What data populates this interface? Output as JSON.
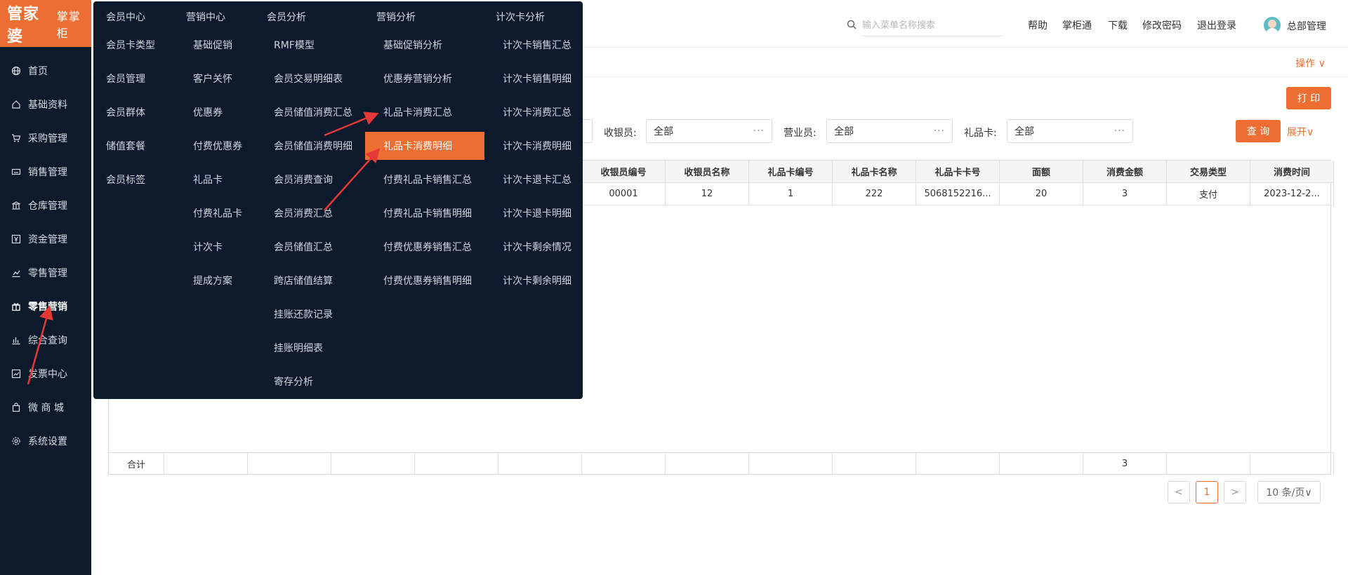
{
  "brand": {
    "name": "管家婆",
    "sub": "掌掌柜"
  },
  "sidebar": {
    "items": [
      {
        "label": "首页",
        "icon": "globe-icon"
      },
      {
        "label": "基础资料",
        "icon": "home-icon"
      },
      {
        "label": "采购管理",
        "icon": "cart-icon"
      },
      {
        "label": "销售管理",
        "icon": "keyboard-icon"
      },
      {
        "label": "仓库管理",
        "icon": "bank-icon"
      },
      {
        "label": "资金管理",
        "icon": "yen-icon"
      },
      {
        "label": "零售管理",
        "icon": "chart-icon"
      },
      {
        "label": "零售营销",
        "icon": "gift-icon"
      },
      {
        "label": "综合查询",
        "icon": "bars-icon"
      },
      {
        "label": "发票中心",
        "icon": "trend-icon"
      },
      {
        "label": "微 商 城",
        "icon": "bag-icon"
      },
      {
        "label": "系统设置",
        "icon": "settings-icon"
      }
    ]
  },
  "header": {
    "search_placeholder": "输入菜单名称搜索",
    "links": [
      "帮助",
      "掌柜通",
      "下载",
      "修改密码",
      "退出登录"
    ],
    "user": "总部管理"
  },
  "toolbar": {
    "ops": "操作 ∨",
    "print": "打 印",
    "query": "查 询",
    "expand": "展开∨"
  },
  "filters": [
    {
      "label": "收银员:",
      "value": "全部"
    },
    {
      "label": "营业员:",
      "value": "全部"
    },
    {
      "label": "礼品卡:",
      "value": "全部"
    }
  ],
  "table": {
    "headers": [
      "收银员编号",
      "收银员名称",
      "礼品卡编号",
      "礼品卡名称",
      "礼品卡卡号",
      "面额",
      "消费金额",
      "交易类型",
      "消费时间"
    ],
    "rows": [
      [
        "00001",
        "12",
        "1",
        "222",
        "5068152216...",
        "20",
        "3",
        "支付",
        "2023-12-2..."
      ]
    ],
    "footer_label": "合计",
    "footer_total": "3"
  },
  "pagination": {
    "prev": "<",
    "current": "1",
    "next": ">",
    "size": "10 条/页∨"
  },
  "mega_menu": {
    "columns": [
      {
        "title": "会员中心",
        "items": [
          "会员卡类型",
          "会员管理",
          "会员群体",
          "储值套餐",
          "会员标签"
        ]
      },
      {
        "title": "营销中心",
        "items": [
          "基础促销",
          "客户关怀",
          "优惠券",
          "付费优惠券",
          "礼品卡",
          "付费礼品卡",
          "计次卡",
          "提成方案"
        ]
      },
      {
        "title": "会员分析",
        "items": [
          "RMF模型",
          "会员交易明细表",
          "会员储值消费汇总",
          "会员储值消费明细",
          "会员消费查询",
          "会员消费汇总",
          "会员储值汇总",
          "跨店储值结算",
          "挂账还款记录",
          "挂账明细表",
          "寄存分析"
        ]
      },
      {
        "title": "营销分析",
        "items": [
          "基础促销分析",
          "优惠券营销分析",
          "礼品卡消费汇总",
          "礼品卡消费明细",
          "付费礼品卡销售汇总",
          "付费礼品卡销售明细",
          "付费优惠券销售汇总",
          "付费优惠券销售明细"
        ]
      },
      {
        "title": "计次卡分析",
        "items": [
          "计次卡销售汇总",
          "计次卡销售明细",
          "计次卡消费汇总",
          "计次卡消费明细",
          "计次卡退卡汇总",
          "计次卡退卡明细",
          "计次卡剩余情况",
          "计次卡剩余明细"
        ]
      }
    ],
    "highlighted": "礼品卡消费明细"
  },
  "colors": {
    "accent": "#ee6d32",
    "sidebar_bg": "#0c1a2c",
    "menu_bg": "#0d1a2d",
    "arrow": "#e53935"
  }
}
